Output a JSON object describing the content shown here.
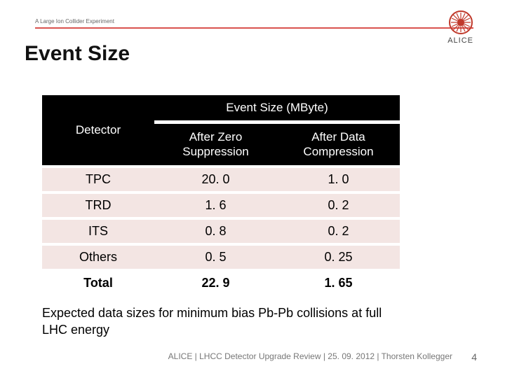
{
  "header": {
    "subtitle": "A Large Ion Collider Experiment",
    "brand": "ALICE"
  },
  "title": "Event Size",
  "chart_data": {
    "type": "table",
    "headers": {
      "detector": "Detector",
      "group": "Event Size (MByte)",
      "col_a": "After Zero Suppression",
      "col_b": "After Data Compression"
    },
    "rows": [
      {
        "detector": "TPC",
        "zero": "20. 0",
        "comp": "1. 0"
      },
      {
        "detector": "TRD",
        "zero": "1. 6",
        "comp": "0. 2"
      },
      {
        "detector": "ITS",
        "zero": "0. 8",
        "comp": "0. 2"
      },
      {
        "detector": "Others",
        "zero": "0. 5",
        "comp": "0. 25"
      }
    ],
    "total": {
      "detector": "Total",
      "zero": "22. 9",
      "comp": "1. 65"
    }
  },
  "note": "Expected data sizes for minimum bias Pb-Pb collisions at full LHC energy",
  "footer": "ALICE |  LHCC Detector Upgrade Review | 25. 09. 2012 | Thorsten Kollegger",
  "page_number": "4"
}
